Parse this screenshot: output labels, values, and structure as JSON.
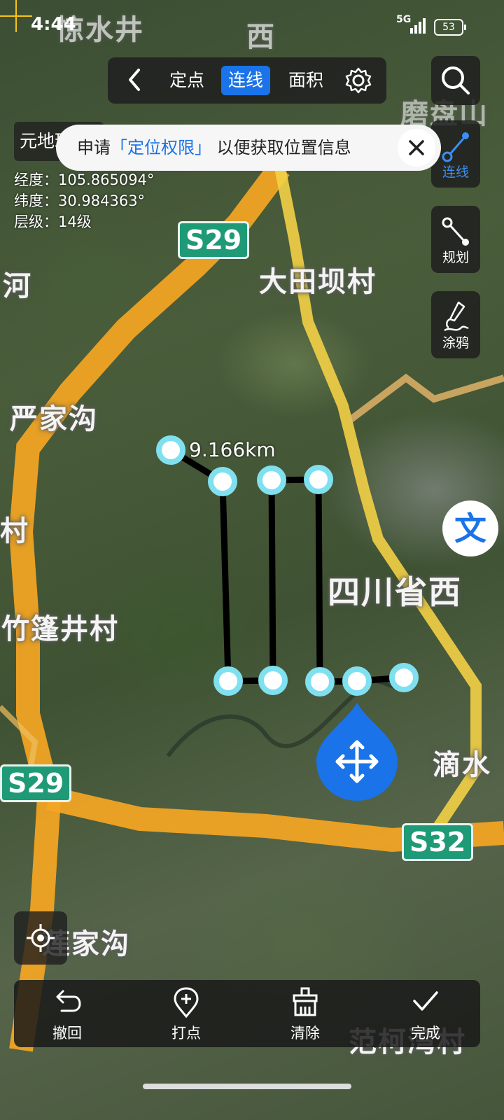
{
  "status_bar": {
    "time": "4:44",
    "network": "5G",
    "battery": "53"
  },
  "toolbar": {
    "back_icon": "chevron-left-icon",
    "tabs": [
      "定点",
      "连线",
      "面积"
    ],
    "active_tab": "连线",
    "settings_icon": "gear-icon"
  },
  "side_tools": {
    "search_icon": "search-icon",
    "items": [
      {
        "label": "连线",
        "icon": "line-tool-icon",
        "active": true
      },
      {
        "label": "规划",
        "icon": "route-plan-icon",
        "active": false
      },
      {
        "label": "涂鸦",
        "icon": "doodle-brush-icon",
        "active": false
      }
    ]
  },
  "info": {
    "tag_label": "元地球",
    "longitude_label": "经度：",
    "longitude": "105.865094°",
    "latitude_label": "纬度：",
    "latitude": "30.984363°",
    "level_label": "层级：",
    "level": "14级"
  },
  "permission_toast": {
    "prefix": "申请",
    "highlight": "「定位权限」",
    "suffix": "以便获取位置信息",
    "close_icon": "close-icon"
  },
  "map": {
    "distance_label": "9.166km",
    "places": [
      "惊水井",
      "西",
      "磨盘山",
      "大田坝村",
      "河",
      "严家沟",
      "村",
      "竹篷井村",
      "四川省西",
      "滴水",
      "莲家沟",
      "范柯湾村"
    ],
    "road_shields": [
      "S29",
      "S29",
      "S32"
    ],
    "text_layer_label": "文",
    "colors": {
      "road": "#f5a623",
      "measure_line": "#000000",
      "point_ring": "#7fe0f0",
      "accent": "#1a73e8"
    }
  },
  "bottom_bar": {
    "items": [
      {
        "label": "撤回",
        "icon": "undo-icon"
      },
      {
        "label": "打点",
        "icon": "add-point-icon"
      },
      {
        "label": "清除",
        "icon": "clear-brush-icon"
      },
      {
        "label": "完成",
        "icon": "check-icon"
      }
    ]
  },
  "locate_icon": "locate-crosshair-icon",
  "move_icon": "move-arrows-icon"
}
